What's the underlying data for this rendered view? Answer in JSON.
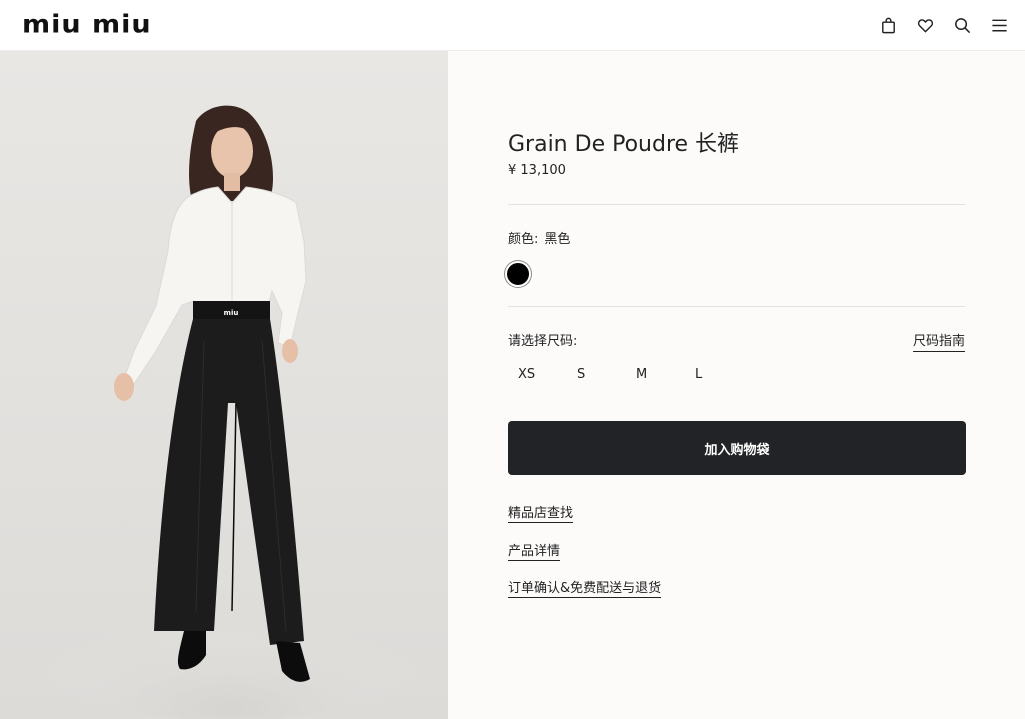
{
  "header": {
    "logo": "miu miu",
    "icons": [
      "shopping-bag-icon",
      "heart-icon",
      "search-icon",
      "menu-icon"
    ]
  },
  "product": {
    "title": "Grain De Poudre 长裤",
    "price": "¥ 13,100",
    "color_label": "颜色:",
    "color_value": "黑色",
    "swatch_color": "#000000",
    "size_label": "请选择尺码:",
    "size_guide": "尺码指南",
    "sizes": [
      "XS",
      "S",
      "M",
      "L"
    ],
    "add_to_bag": "加入购物袋",
    "links": [
      "精品店查找",
      "产品详情",
      "订单确认&免费配送与退货"
    ]
  },
  "colors": {
    "button_bg": "#222326",
    "panel_bg": "#fcfbfa",
    "photo_bg": "#e6e4e1"
  }
}
